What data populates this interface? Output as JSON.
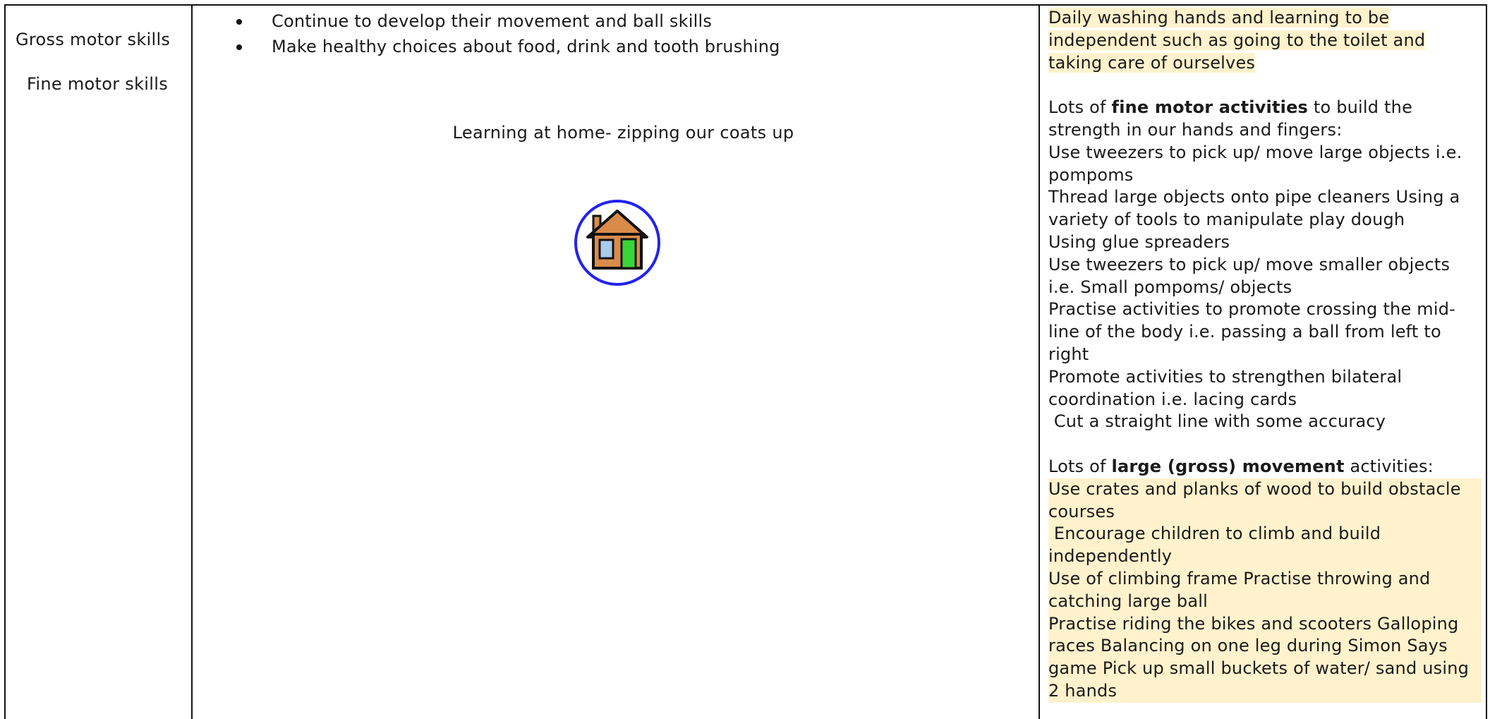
{
  "left_column": {
    "areas": [
      "Gross motor skills",
      "Fine motor skills"
    ]
  },
  "middle_column": {
    "goals": [
      "Continue to develop their movement and ball skills",
      "Make healthy choices about food, drink and tooth brushing"
    ],
    "home_learning_caption": "Learning at home- zipping our coats up",
    "home_icon": "house-icon"
  },
  "right_column": {
    "highlight_color": "#fff2cc",
    "independence": "Daily washing hands and learning to be independent such as going to the toilet and taking care of ourselves",
    "fine_intro_pre": "Lots of ",
    "fine_intro_bold": "fine motor activities",
    "fine_intro_post": " to build the strength in our hands and fingers:",
    "fine_activities": [
      "Use tweezers to pick up/ move large objects i.e. pompoms",
      "Thread large objects onto pipe cleaners Using a variety of tools to manipulate play dough",
      "Using glue spreaders",
      "Use tweezers to pick up/ move smaller objects i.e. Small pompoms/ objects",
      "Practise activities to promote crossing the mid-line of the body i.e. passing a ball from left to right",
      "Promote activities to strengthen bilateral coordination i.e. lacing cards",
      " Cut a straight line with some accuracy"
    ],
    "gross_intro_pre": "Lots of ",
    "gross_intro_bold": "large (gross) movement",
    "gross_intro_post": " activities:",
    "gross_activities": [
      "Use crates and planks of wood to build obstacle courses",
      " Encourage children to climb and build independently",
      "Use of climbing frame Practise throwing and catching large ball",
      "Practise riding the bikes and scooters Galloping races Balancing on one leg during Simon Says game Pick up small buckets of water/ sand using 2 hands"
    ]
  }
}
